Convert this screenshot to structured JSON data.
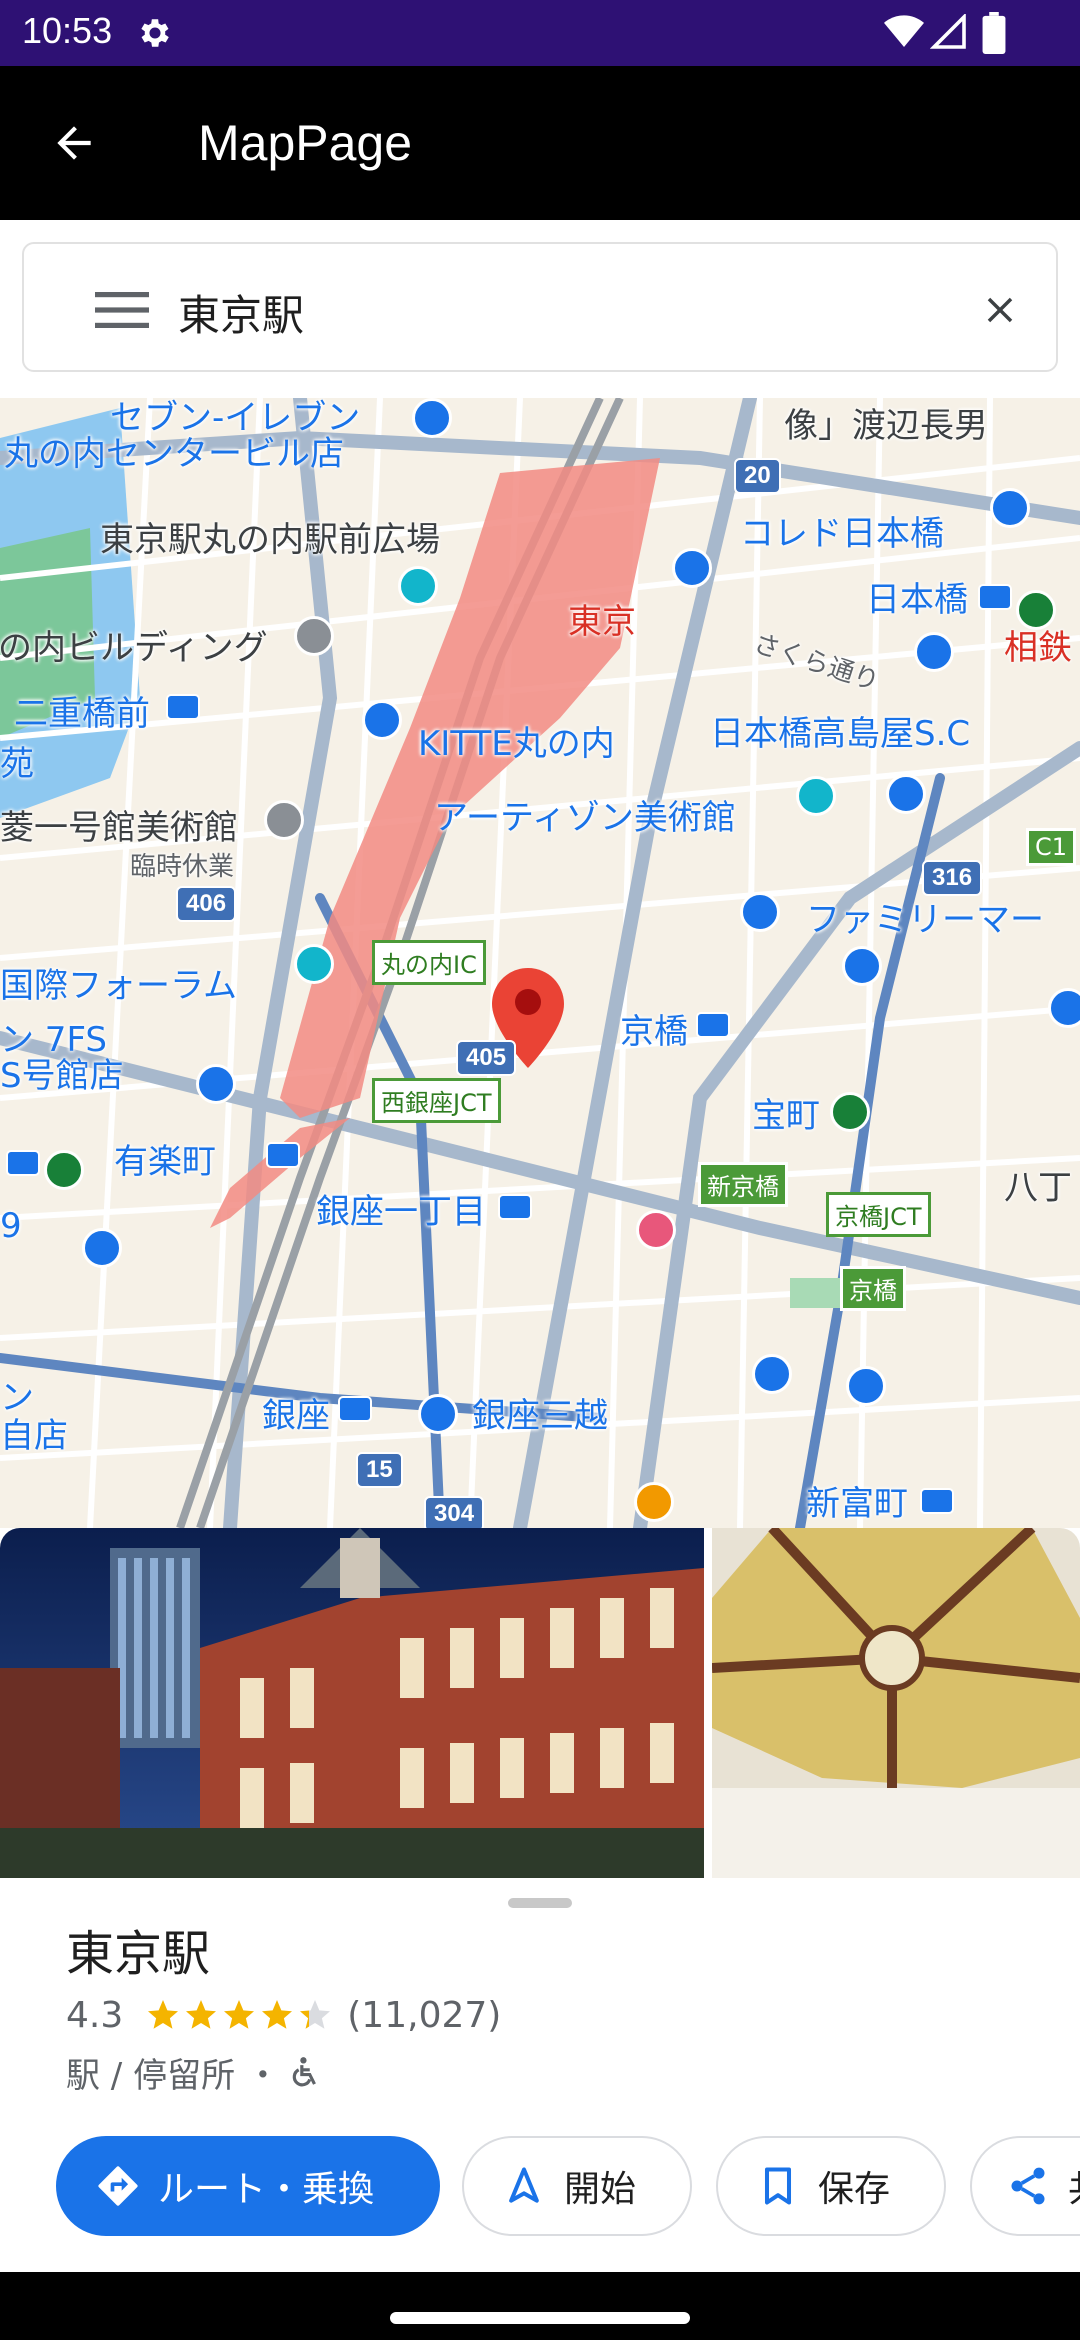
{
  "status_bar": {
    "time": "10:53"
  },
  "app_bar": {
    "title": "MapPage"
  },
  "search": {
    "query": "東京駅"
  },
  "map": {
    "labels": {
      "seven_eleven": "セブン-イレブン",
      "marunouchi_center": "丸の内センタービル店",
      "ekimae_hiroba": "東京駅丸の内駅前広場",
      "building": "の内ビルディング",
      "nijubashimae": "二重橋前",
      "en": "苑",
      "mitsubishi": "菱一号館美術館",
      "rinji": "臨時休業",
      "kokusai_forum": "国際フォーラム",
      "n_7fs": "ン 7FS",
      "s_gokan": "S号館店",
      "yurakucho": "有楽町",
      "ginza_itchome": "銀座一丁目",
      "ginza": "銀座",
      "ginza_mitsukoshi": "銀座三越",
      "shintomicho": "新富町",
      "tokyo": "東京",
      "kitte": "KITTE丸の内",
      "artizon": "アーティゾン美術館",
      "kyobashi": "京橋",
      "takaracho": "宝町",
      "familymart": "ファミリーマー",
      "takashimaya": "日本橋高島屋S.C",
      "coredo": "コレド日本橋",
      "nihonbashi": "日本橋",
      "watanabe": "像」渡辺長男",
      "sakura_dori": "さくら通り",
      "sotetsu": "相鉄",
      "hatchobori": "八丁",
      "ken": "ン",
      "jiten": "自店",
      "nine": "9"
    },
    "badges": {
      "r20": "20",
      "r316": "316",
      "r406": "406",
      "r405": "405",
      "r15": "15",
      "r304": "304",
      "c1": "C1",
      "marunouchi_ic": "丸の内IC",
      "nishiginza_jct": "西銀座JCT",
      "shinkyobashi": "新京橋",
      "kyobashi_jct": "京橋JCT",
      "kyobashi_exit": "京橋"
    }
  },
  "place": {
    "name": "東京駅",
    "rating": "4.3",
    "rating_value": 4.3,
    "reviews": "(11,027)",
    "category": "駅 / 停留所 ・"
  },
  "actions": {
    "directions": "ルート・乗換",
    "start": "開始",
    "save": "保存",
    "share": "共"
  },
  "colors": {
    "status_bar": "#2e1174",
    "accent": "#1a73e8",
    "star": "#f4b400",
    "station_red": "#f28b82"
  }
}
